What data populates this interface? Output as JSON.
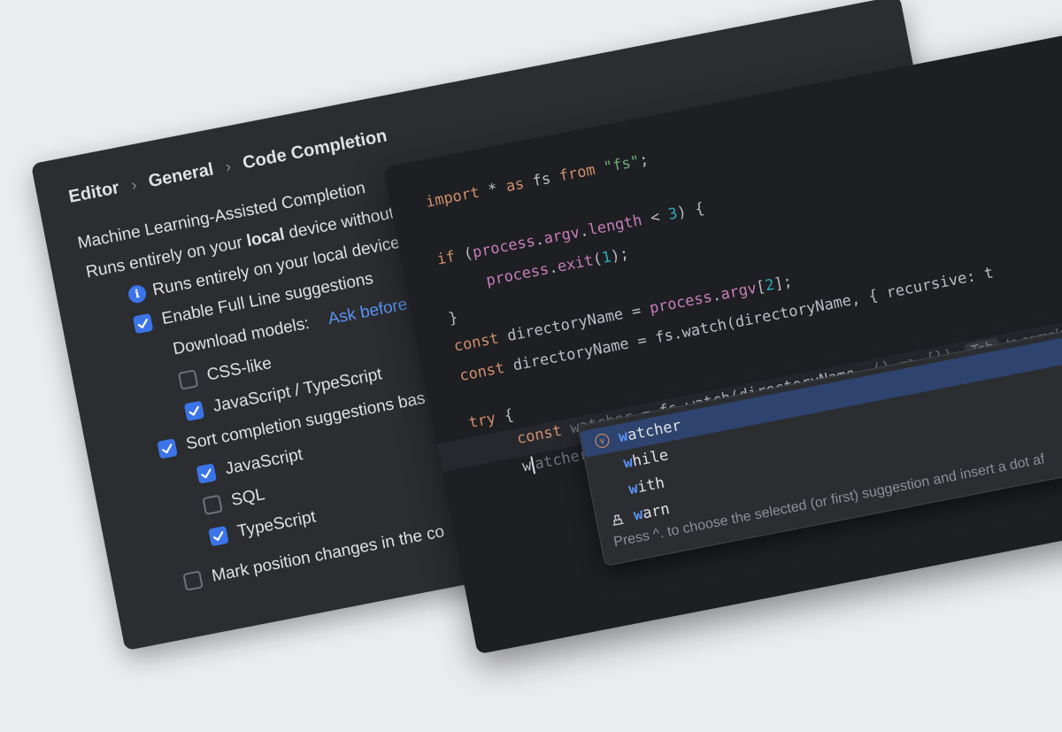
{
  "breadcrumb": [
    "Editor",
    "General",
    "Code Completion"
  ],
  "settings": {
    "section_title": "Machine Learning-Assisted Completion",
    "local_pre": "Runs entirely on your ",
    "local_bold": "local",
    "local_post": " device without sending anything over the internet",
    "full_line": "Enable Full Line suggestions",
    "download_label": "Download models:",
    "download_value": "Ask before",
    "models": [
      {
        "label": "CSS-like",
        "checked": false
      },
      {
        "label": "JavaScript / TypeScript",
        "checked": true
      }
    ],
    "sort_label": "Sort completion suggestions bas",
    "sort_items": [
      {
        "label": "JavaScript",
        "checked": true
      },
      {
        "label": "SQL",
        "checked": false
      },
      {
        "label": "TypeScript",
        "checked": true
      }
    ],
    "mark_label": "Mark position changes in the co"
  },
  "editor": {
    "tab_key": "Tab",
    "tab_hint": "to complete",
    "popup": {
      "items": [
        {
          "match": "w",
          "rest": "atcher",
          "icon": "variable-icon",
          "icon_letter": "v",
          "selected": true
        },
        {
          "match": "w",
          "rest": "hile",
          "icon": "",
          "selected": false
        },
        {
          "match": "w",
          "rest": "ith",
          "icon": "",
          "selected": false
        },
        {
          "match": "w",
          "rest": "arn",
          "icon": "function-icon",
          "selected": false
        }
      ],
      "footer": "Press ^. to choose the selected (or first) suggestion and insert a dot af"
    }
  },
  "colors": {
    "accent": "#3b74e8",
    "keyword": "#cf8e6d",
    "member": "#c77dbb",
    "number": "#2aacb8",
    "string": "#6aab73"
  }
}
